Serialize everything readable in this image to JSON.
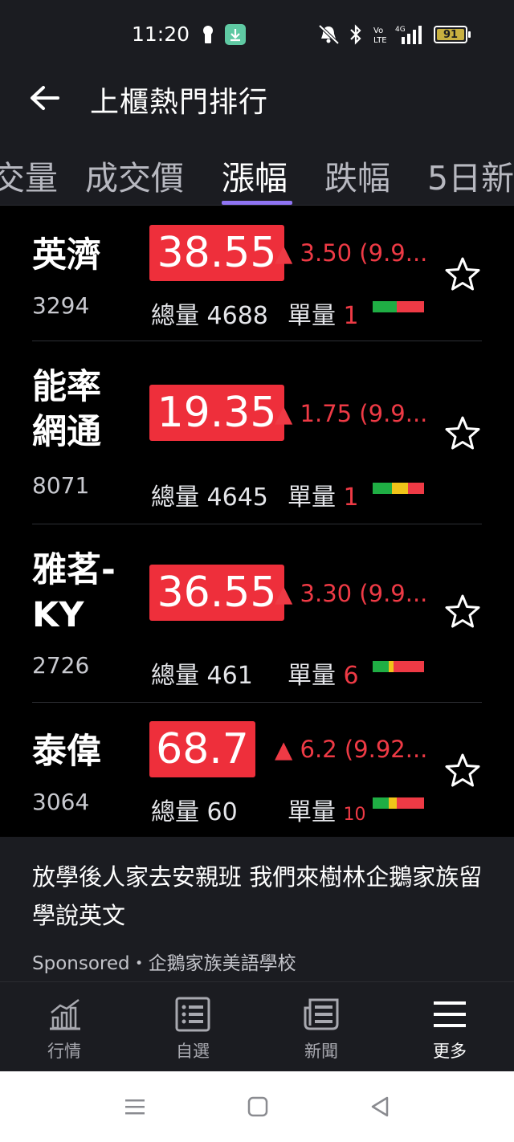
{
  "status_bar": {
    "time": "11:20",
    "battery": "91",
    "network": "4G"
  },
  "header": {
    "title": "上櫃熱門排行"
  },
  "tabs": [
    {
      "label": "交量",
      "active": false
    },
    {
      "label": "成交價",
      "active": false
    },
    {
      "label": "漲幅",
      "active": true
    },
    {
      "label": "跌幅",
      "active": false
    },
    {
      "label": "5日新",
      "active": false
    }
  ],
  "stocks": [
    {
      "name_lines": [
        "英濟"
      ],
      "code": "3294",
      "price": "38.55",
      "change": "▲ 3.50 (9.9...",
      "total_label": "總量",
      "total_volume": "4688",
      "unit_label": "單量",
      "unit_volume": "1",
      "colors": [
        "#1fae44",
        "#ee3a45"
      ]
    },
    {
      "name_lines": [
        "能率",
        "網通"
      ],
      "code": "8071",
      "price": "19.35",
      "change": "▲ 1.75 (9.9...",
      "total_label": "總量",
      "total_volume": "4645",
      "unit_label": "單量",
      "unit_volume": "1",
      "colors": [
        "#1fae44",
        "#f0c419",
        "#ee3a45"
      ]
    },
    {
      "name_lines": [
        "雅茗-",
        "KY"
      ],
      "code": "2726",
      "price": "36.55",
      "change": "▲ 3.30 (9.9...",
      "total_label": "總量",
      "total_volume": "461",
      "unit_label": "單量",
      "unit_volume": "6",
      "colors": [
        "#1fae44",
        "#f0c419",
        "#ee3a45"
      ]
    },
    {
      "name_lines": [
        "泰偉"
      ],
      "code": "3064",
      "price": "68.7",
      "change": "▲ 6.2 (9.92...",
      "total_label": "總量",
      "total_volume": "60",
      "unit_label": "單量",
      "unit_volume": "10",
      "colors": [
        "#1fae44",
        "#f0c419",
        "#ee3a45"
      ]
    }
  ],
  "ad": {
    "headline": "放學後人家去安親班 我們來樹林企鵝家族留學說英文",
    "sponsor": "Sponsored・企鵝家族美語學校"
  },
  "bottom_nav": [
    {
      "label": "行情",
      "icon": "chart-icon"
    },
    {
      "label": "自選",
      "icon": "list-icon"
    },
    {
      "label": "新聞",
      "icon": "news-icon"
    },
    {
      "label": "更多",
      "icon": "menu-icon",
      "active": true
    }
  ],
  "colors": {
    "up_red": "#ee2f3b",
    "accent": "#8f74f3",
    "background": "#000000"
  }
}
